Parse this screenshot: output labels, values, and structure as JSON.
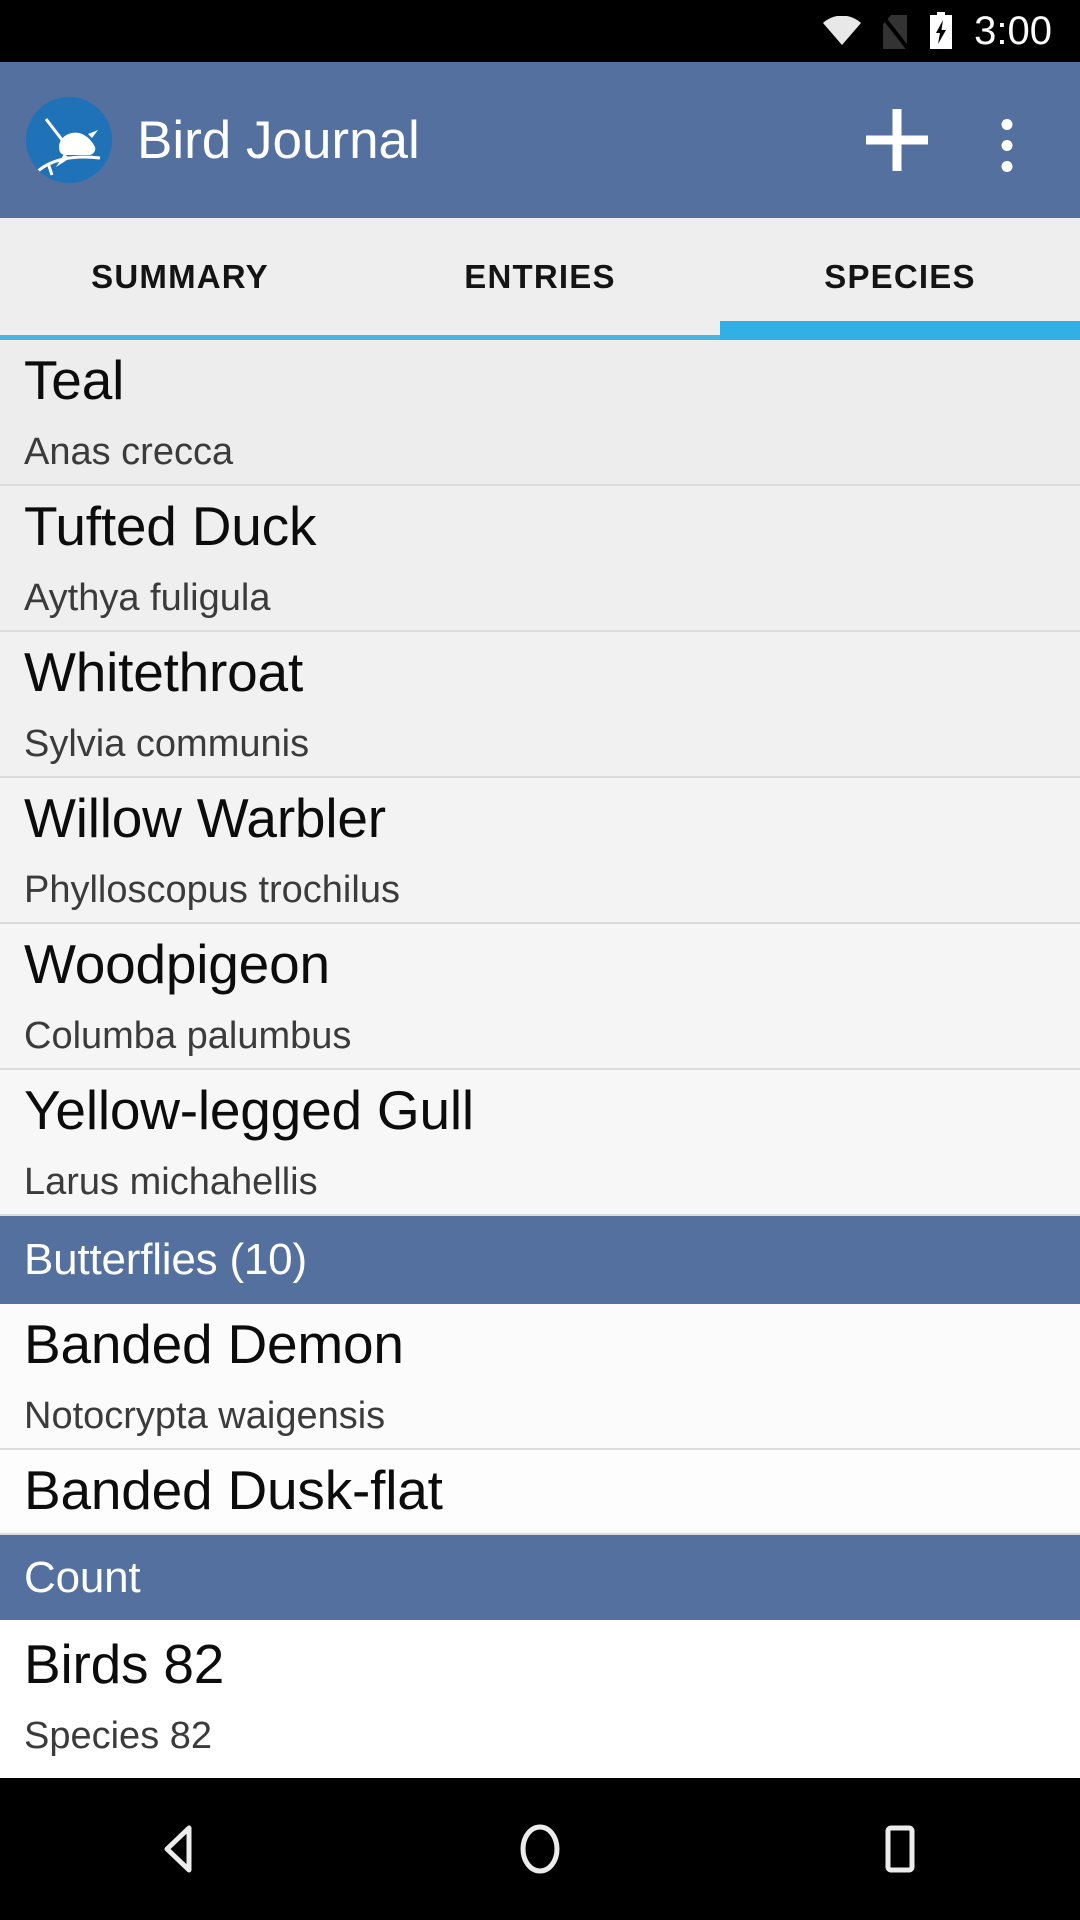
{
  "statusbar": {
    "time": "3:00",
    "icons": [
      "wifi-icon",
      "no-sim-icon",
      "battery-charging-icon"
    ]
  },
  "appbar": {
    "title": "Bird Journal",
    "app_icon": "bird-logo-icon",
    "add_label": "+",
    "overflow_label": "⋮",
    "background": "#53709e"
  },
  "tabs": {
    "items": [
      {
        "label": "SUMMARY",
        "selected": false
      },
      {
        "label": "ENTRIES",
        "selected": false
      },
      {
        "label": "SPECIES",
        "selected": true
      }
    ],
    "indicator_color": "#30b0e4"
  },
  "list": {
    "rows": [
      {
        "kind": "item",
        "primary": "Teal",
        "secondary": "Anas crecca",
        "bg": "#ededed"
      },
      {
        "kind": "item",
        "primary": "Tufted Duck",
        "secondary": "Aythya fuligula",
        "bg": "#efefef"
      },
      {
        "kind": "item",
        "primary": "Whitethroat",
        "secondary": "Sylvia communis",
        "bg": "#f1f1f1"
      },
      {
        "kind": "item",
        "primary": "Willow Warbler",
        "secondary": "Phylloscopus trochilus",
        "bg": "#f3f3f3"
      },
      {
        "kind": "item",
        "primary": "Woodpigeon",
        "secondary": "Columba palumbus",
        "bg": "#f5f5f5"
      },
      {
        "kind": "item",
        "primary": "Yellow-legged Gull",
        "secondary": "Larus michahellis",
        "bg": "#f7f7f7"
      },
      {
        "kind": "header",
        "primary": "Butterflies (10)"
      },
      {
        "kind": "item",
        "primary": "Banded Demon",
        "secondary": "Notocrypta waigensis",
        "bg": "#fbfbfb"
      },
      {
        "kind": "item-single",
        "primary": "Banded Dusk-flat",
        "bg": "#fdfdfd"
      },
      {
        "kind": "header",
        "primary": "Count"
      },
      {
        "kind": "count",
        "primary": "Birds 82",
        "secondary": "Species 82",
        "bg": "#ffffff"
      }
    ]
  },
  "navbar": {
    "back_label": "back-icon",
    "home_label": "home-icon",
    "recents_label": "recents-icon"
  }
}
